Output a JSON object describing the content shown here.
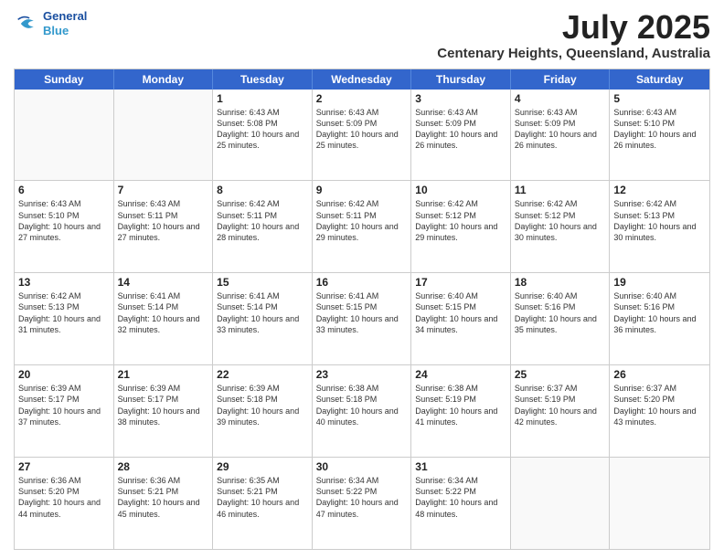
{
  "header": {
    "logo_line1": "General",
    "logo_line2": "Blue",
    "main_title": "July 2025",
    "subtitle": "Centenary Heights, Queensland, Australia"
  },
  "calendar": {
    "days_of_week": [
      "Sunday",
      "Monday",
      "Tuesday",
      "Wednesday",
      "Thursday",
      "Friday",
      "Saturday"
    ],
    "weeks": [
      [
        {
          "day": "",
          "sunrise": "",
          "sunset": "",
          "daylight": ""
        },
        {
          "day": "",
          "sunrise": "",
          "sunset": "",
          "daylight": ""
        },
        {
          "day": "1",
          "sunrise": "Sunrise: 6:43 AM",
          "sunset": "Sunset: 5:08 PM",
          "daylight": "Daylight: 10 hours and 25 minutes."
        },
        {
          "day": "2",
          "sunrise": "Sunrise: 6:43 AM",
          "sunset": "Sunset: 5:09 PM",
          "daylight": "Daylight: 10 hours and 25 minutes."
        },
        {
          "day": "3",
          "sunrise": "Sunrise: 6:43 AM",
          "sunset": "Sunset: 5:09 PM",
          "daylight": "Daylight: 10 hours and 26 minutes."
        },
        {
          "day": "4",
          "sunrise": "Sunrise: 6:43 AM",
          "sunset": "Sunset: 5:09 PM",
          "daylight": "Daylight: 10 hours and 26 minutes."
        },
        {
          "day": "5",
          "sunrise": "Sunrise: 6:43 AM",
          "sunset": "Sunset: 5:10 PM",
          "daylight": "Daylight: 10 hours and 26 minutes."
        }
      ],
      [
        {
          "day": "6",
          "sunrise": "Sunrise: 6:43 AM",
          "sunset": "Sunset: 5:10 PM",
          "daylight": "Daylight: 10 hours and 27 minutes."
        },
        {
          "day": "7",
          "sunrise": "Sunrise: 6:43 AM",
          "sunset": "Sunset: 5:11 PM",
          "daylight": "Daylight: 10 hours and 27 minutes."
        },
        {
          "day": "8",
          "sunrise": "Sunrise: 6:42 AM",
          "sunset": "Sunset: 5:11 PM",
          "daylight": "Daylight: 10 hours and 28 minutes."
        },
        {
          "day": "9",
          "sunrise": "Sunrise: 6:42 AM",
          "sunset": "Sunset: 5:11 PM",
          "daylight": "Daylight: 10 hours and 29 minutes."
        },
        {
          "day": "10",
          "sunrise": "Sunrise: 6:42 AM",
          "sunset": "Sunset: 5:12 PM",
          "daylight": "Daylight: 10 hours and 29 minutes."
        },
        {
          "day": "11",
          "sunrise": "Sunrise: 6:42 AM",
          "sunset": "Sunset: 5:12 PM",
          "daylight": "Daylight: 10 hours and 30 minutes."
        },
        {
          "day": "12",
          "sunrise": "Sunrise: 6:42 AM",
          "sunset": "Sunset: 5:13 PM",
          "daylight": "Daylight: 10 hours and 30 minutes."
        }
      ],
      [
        {
          "day": "13",
          "sunrise": "Sunrise: 6:42 AM",
          "sunset": "Sunset: 5:13 PM",
          "daylight": "Daylight: 10 hours and 31 minutes."
        },
        {
          "day": "14",
          "sunrise": "Sunrise: 6:41 AM",
          "sunset": "Sunset: 5:14 PM",
          "daylight": "Daylight: 10 hours and 32 minutes."
        },
        {
          "day": "15",
          "sunrise": "Sunrise: 6:41 AM",
          "sunset": "Sunset: 5:14 PM",
          "daylight": "Daylight: 10 hours and 33 minutes."
        },
        {
          "day": "16",
          "sunrise": "Sunrise: 6:41 AM",
          "sunset": "Sunset: 5:15 PM",
          "daylight": "Daylight: 10 hours and 33 minutes."
        },
        {
          "day": "17",
          "sunrise": "Sunrise: 6:40 AM",
          "sunset": "Sunset: 5:15 PM",
          "daylight": "Daylight: 10 hours and 34 minutes."
        },
        {
          "day": "18",
          "sunrise": "Sunrise: 6:40 AM",
          "sunset": "Sunset: 5:16 PM",
          "daylight": "Daylight: 10 hours and 35 minutes."
        },
        {
          "day": "19",
          "sunrise": "Sunrise: 6:40 AM",
          "sunset": "Sunset: 5:16 PM",
          "daylight": "Daylight: 10 hours and 36 minutes."
        }
      ],
      [
        {
          "day": "20",
          "sunrise": "Sunrise: 6:39 AM",
          "sunset": "Sunset: 5:17 PM",
          "daylight": "Daylight: 10 hours and 37 minutes."
        },
        {
          "day": "21",
          "sunrise": "Sunrise: 6:39 AM",
          "sunset": "Sunset: 5:17 PM",
          "daylight": "Daylight: 10 hours and 38 minutes."
        },
        {
          "day": "22",
          "sunrise": "Sunrise: 6:39 AM",
          "sunset": "Sunset: 5:18 PM",
          "daylight": "Daylight: 10 hours and 39 minutes."
        },
        {
          "day": "23",
          "sunrise": "Sunrise: 6:38 AM",
          "sunset": "Sunset: 5:18 PM",
          "daylight": "Daylight: 10 hours and 40 minutes."
        },
        {
          "day": "24",
          "sunrise": "Sunrise: 6:38 AM",
          "sunset": "Sunset: 5:19 PM",
          "daylight": "Daylight: 10 hours and 41 minutes."
        },
        {
          "day": "25",
          "sunrise": "Sunrise: 6:37 AM",
          "sunset": "Sunset: 5:19 PM",
          "daylight": "Daylight: 10 hours and 42 minutes."
        },
        {
          "day": "26",
          "sunrise": "Sunrise: 6:37 AM",
          "sunset": "Sunset: 5:20 PM",
          "daylight": "Daylight: 10 hours and 43 minutes."
        }
      ],
      [
        {
          "day": "27",
          "sunrise": "Sunrise: 6:36 AM",
          "sunset": "Sunset: 5:20 PM",
          "daylight": "Daylight: 10 hours and 44 minutes."
        },
        {
          "day": "28",
          "sunrise": "Sunrise: 6:36 AM",
          "sunset": "Sunset: 5:21 PM",
          "daylight": "Daylight: 10 hours and 45 minutes."
        },
        {
          "day": "29",
          "sunrise": "Sunrise: 6:35 AM",
          "sunset": "Sunset: 5:21 PM",
          "daylight": "Daylight: 10 hours and 46 minutes."
        },
        {
          "day": "30",
          "sunrise": "Sunrise: 6:34 AM",
          "sunset": "Sunset: 5:22 PM",
          "daylight": "Daylight: 10 hours and 47 minutes."
        },
        {
          "day": "31",
          "sunrise": "Sunrise: 6:34 AM",
          "sunset": "Sunset: 5:22 PM",
          "daylight": "Daylight: 10 hours and 48 minutes."
        },
        {
          "day": "",
          "sunrise": "",
          "sunset": "",
          "daylight": ""
        },
        {
          "day": "",
          "sunrise": "",
          "sunset": "",
          "daylight": ""
        }
      ]
    ]
  }
}
